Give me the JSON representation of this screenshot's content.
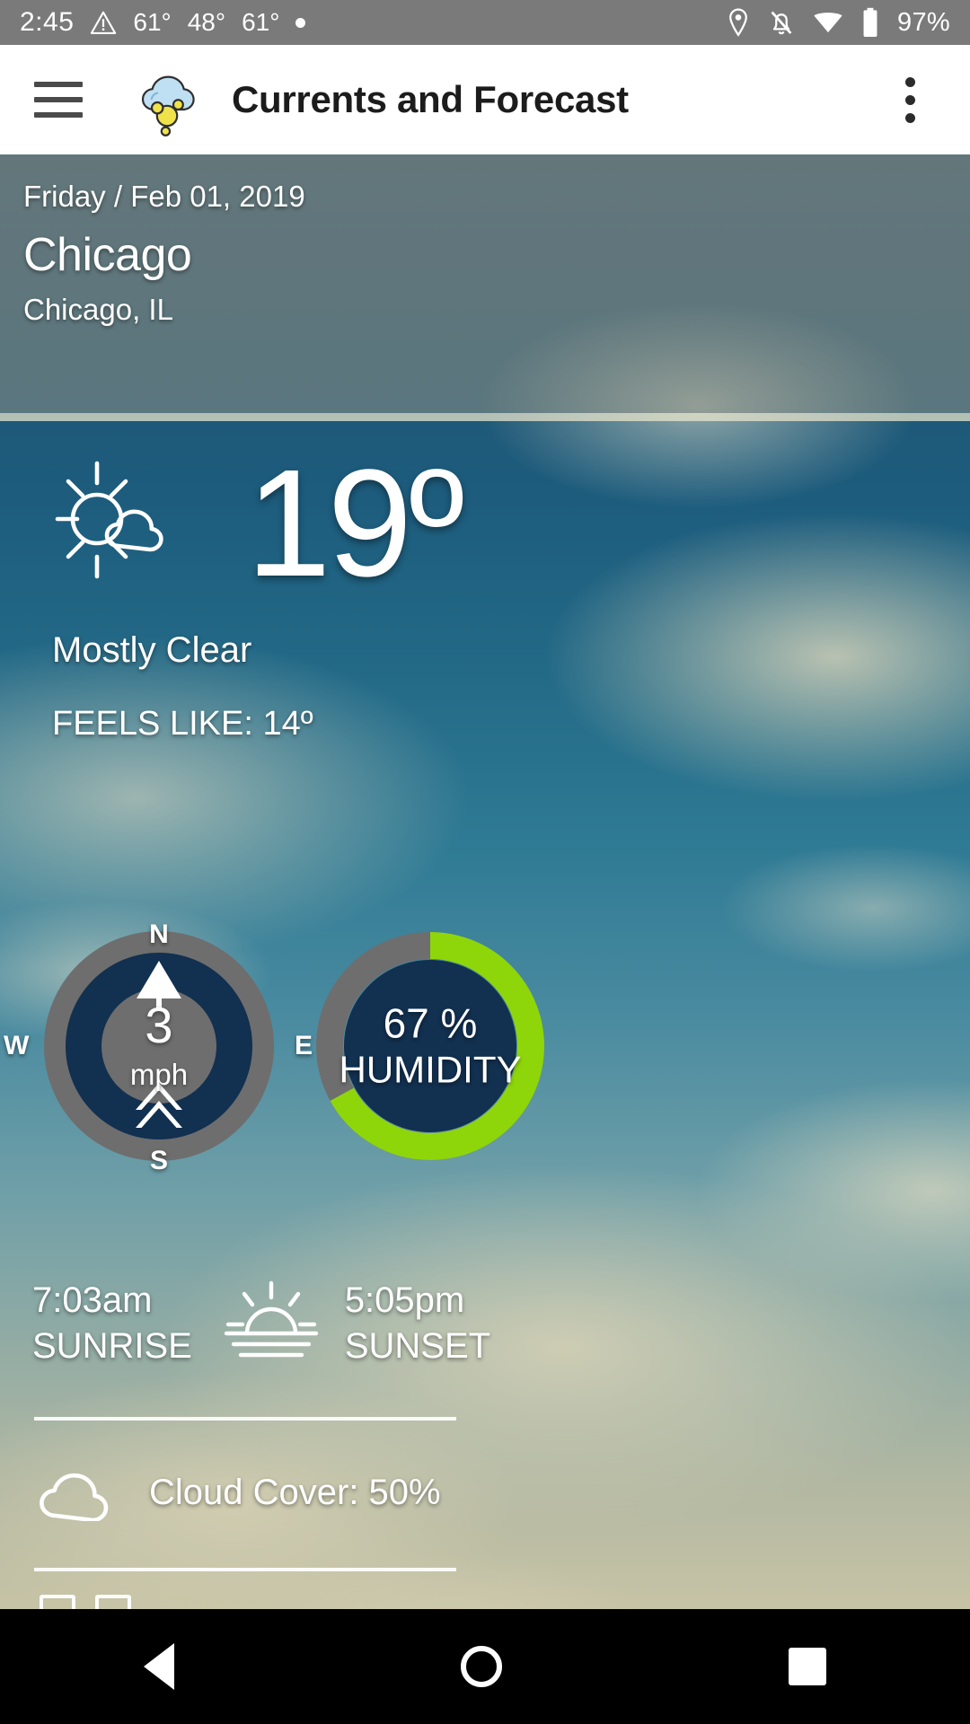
{
  "statusbar": {
    "time": "2:45",
    "warning_icon": "warning-triangle-icon",
    "temps": [
      "61°",
      "48°",
      "61°"
    ],
    "dot": "•",
    "location_icon": "location-pin-icon",
    "notifications_icon": "bell-muted-icon",
    "wifi_icon": "wifi-icon",
    "battery_icon": "battery-icon",
    "battery_pct": "97%"
  },
  "appbar": {
    "menu_icon": "hamburger-menu-icon",
    "logo_icon": "cloud-sun-logo-icon",
    "title": "Currents and Forecast",
    "overflow_icon": "kebab-menu-icon"
  },
  "location": {
    "date": "Friday / Feb 01, 2019",
    "city": "Chicago",
    "region": "Chicago, IL"
  },
  "current": {
    "condition_icon": "sun-behind-cloud-icon",
    "temperature": "19º",
    "condition": "Mostly Clear",
    "feels_like": "FEELS LIKE: 14º"
  },
  "wind": {
    "label_n": "N",
    "label_e": "E",
    "label_s": "S",
    "label_w": "W",
    "speed": "3",
    "unit": "mph",
    "direction_icon": "wind-direction-needle-icon",
    "direction_degrees": 0,
    "ring_color": "#6e6e6e",
    "inner_color": "#123050"
  },
  "humidity": {
    "value": "67 %",
    "caption": "HUMIDITY",
    "percent": 67,
    "arc_color": "#8ed60a",
    "track_color": "#6e6e6e",
    "inner_color": "#123050"
  },
  "sun": {
    "sunrise_time": "7:03am",
    "sunrise_label": "SUNRISE",
    "icon": "sunrise-horizon-icon",
    "sunset_time": "5:05pm",
    "sunset_label": "SUNSET"
  },
  "cloud": {
    "icon": "cloud-icon",
    "text": "Cloud Cover: 50%"
  },
  "navbar": {
    "back": "back-triangle-icon",
    "home": "home-circle-icon",
    "recents": "recents-square-icon"
  }
}
